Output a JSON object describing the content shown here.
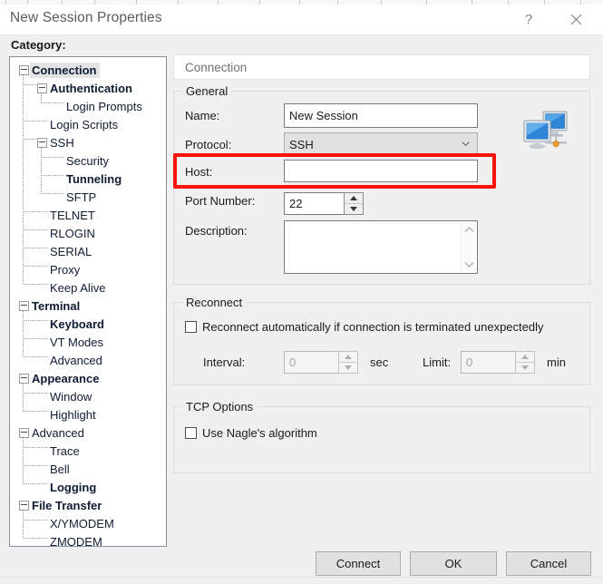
{
  "window": {
    "title": "New Session Properties",
    "help_icon": "question-mark-icon",
    "close_icon": "close-icon"
  },
  "category": {
    "label": "Category:",
    "tree": [
      {
        "label": "Connection",
        "depth": 0,
        "bold": true,
        "expander": true,
        "selected": true
      },
      {
        "label": "Authentication",
        "depth": 1,
        "bold": true,
        "expander": true,
        "selected": false
      },
      {
        "label": "Login Prompts",
        "depth": 2,
        "bold": false,
        "expander": false,
        "selected": false
      },
      {
        "label": "Login Scripts",
        "depth": 1,
        "bold": false,
        "expander": false,
        "selected": false
      },
      {
        "label": "SSH",
        "depth": 1,
        "bold": false,
        "expander": true,
        "selected": false
      },
      {
        "label": "Security",
        "depth": 2,
        "bold": false,
        "expander": false,
        "selected": false
      },
      {
        "label": "Tunneling",
        "depth": 2,
        "bold": true,
        "expander": false,
        "selected": false
      },
      {
        "label": "SFTP",
        "depth": 2,
        "bold": false,
        "expander": false,
        "selected": false
      },
      {
        "label": "TELNET",
        "depth": 1,
        "bold": false,
        "expander": false,
        "selected": false
      },
      {
        "label": "RLOGIN",
        "depth": 1,
        "bold": false,
        "expander": false,
        "selected": false
      },
      {
        "label": "SERIAL",
        "depth": 1,
        "bold": false,
        "expander": false,
        "selected": false
      },
      {
        "label": "Proxy",
        "depth": 1,
        "bold": false,
        "expander": false,
        "selected": false
      },
      {
        "label": "Keep Alive",
        "depth": 1,
        "bold": false,
        "expander": false,
        "selected": false
      },
      {
        "label": "Terminal",
        "depth": 0,
        "bold": true,
        "expander": true,
        "selected": false
      },
      {
        "label": "Keyboard",
        "depth": 1,
        "bold": true,
        "expander": false,
        "selected": false
      },
      {
        "label": "VT Modes",
        "depth": 1,
        "bold": false,
        "expander": false,
        "selected": false
      },
      {
        "label": "Advanced",
        "depth": 1,
        "bold": false,
        "expander": false,
        "selected": false
      },
      {
        "label": "Appearance",
        "depth": 0,
        "bold": true,
        "expander": true,
        "selected": false
      },
      {
        "label": "Window",
        "depth": 1,
        "bold": false,
        "expander": false,
        "selected": false
      },
      {
        "label": "Highlight",
        "depth": 1,
        "bold": false,
        "expander": false,
        "selected": false
      },
      {
        "label": "Advanced",
        "depth": 0,
        "bold": false,
        "expander": true,
        "selected": false
      },
      {
        "label": "Trace",
        "depth": 1,
        "bold": false,
        "expander": false,
        "selected": false
      },
      {
        "label": "Bell",
        "depth": 1,
        "bold": false,
        "expander": false,
        "selected": false
      },
      {
        "label": "Logging",
        "depth": 1,
        "bold": true,
        "expander": false,
        "selected": false
      },
      {
        "label": "File Transfer",
        "depth": 0,
        "bold": true,
        "expander": true,
        "selected": false
      },
      {
        "label": "X/YMODEM",
        "depth": 1,
        "bold": false,
        "expander": false,
        "selected": false
      },
      {
        "label": "ZMODEM",
        "depth": 1,
        "bold": false,
        "expander": false,
        "selected": false
      }
    ]
  },
  "page_header": {
    "title": "Connection"
  },
  "general": {
    "title": "General",
    "name_label": "Name:",
    "name_value": "New Session",
    "protocol_label": "Protocol:",
    "protocol_value": "SSH",
    "host_label": "Host:",
    "host_value": "",
    "port_label": "Port Number:",
    "port_value": "22",
    "description_label": "Description:",
    "description_value": "",
    "icon": "network-computers-icon"
  },
  "reconnect": {
    "title": "Reconnect",
    "auto_label": "Reconnect automatically if connection is terminated unexpectedly",
    "auto_checked": false,
    "interval_label": "Interval:",
    "interval_value": "0",
    "interval_unit": "sec",
    "limit_label": "Limit:",
    "limit_value": "0",
    "limit_unit": "min"
  },
  "tcp_options": {
    "title": "TCP Options",
    "nagle_label": "Use Nagle's algorithm",
    "nagle_checked": false
  },
  "footer": {
    "connect_label": "Connect",
    "ok_label": "OK",
    "cancel_label": "Cancel"
  },
  "annotation": {
    "color": "#fb1208",
    "target": "host-field-row"
  }
}
